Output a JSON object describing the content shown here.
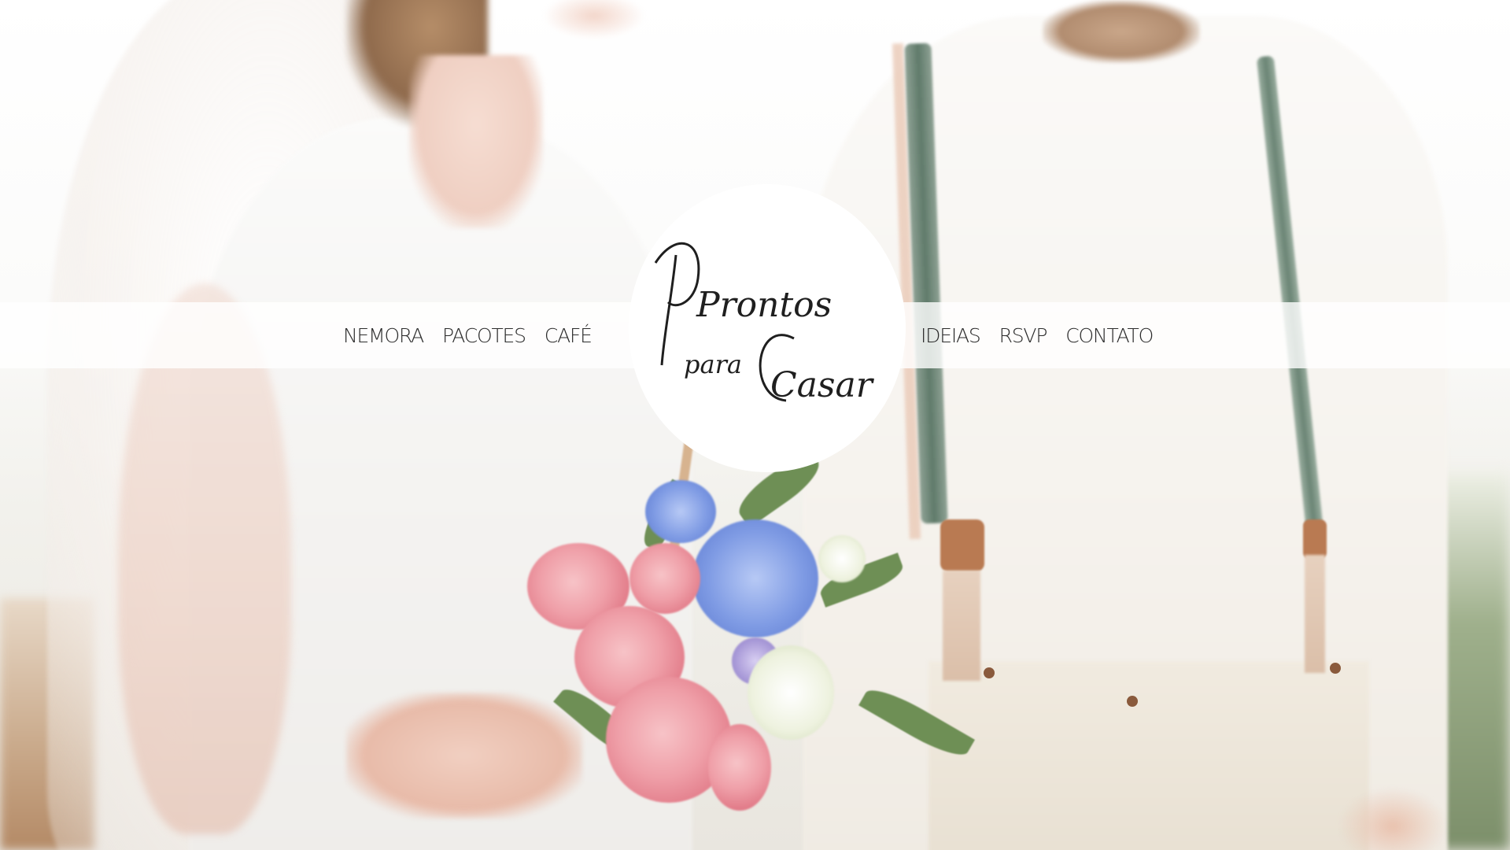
{
  "brand": {
    "line1": "Prontos",
    "line2": "para",
    "line3": "Casar"
  },
  "nav": {
    "left": [
      "NEMORA",
      "PACOTES",
      "CAFÉ"
    ],
    "right": [
      "IDEIAS",
      "RSVP",
      "CONTATO"
    ]
  },
  "colors": {
    "nav_text": "#2b2b2b",
    "nav_bar": "rgba(255,255,255,0.80)",
    "logo_bg": "#ffffff"
  }
}
